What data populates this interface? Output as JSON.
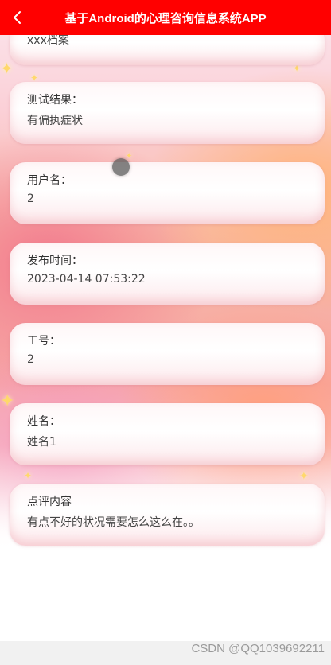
{
  "header": {
    "title": "基于Android的心理咨询信息系统APP",
    "background_color": "#ff0000",
    "back_icon": "chevron-left-icon"
  },
  "partial_card": {
    "value": "xxx档案"
  },
  "fields": [
    {
      "label": "测试结果：",
      "value": "有偏执症状"
    },
    {
      "label": "用户名：",
      "value": "2"
    },
    {
      "label": "发布时间：",
      "value": "2023-04-14 07:53:22"
    },
    {
      "label": "工号：",
      "value": "2"
    },
    {
      "label": "姓名：",
      "value": "姓名1"
    },
    {
      "label": "点评内容",
      "value": "有点不好的状况需要怎么这么在。。"
    }
  ],
  "watermark": "CSDN @QQ1039692211",
  "colors": {
    "card_bg": "#fff5f7",
    "accent": "#ff0000"
  }
}
